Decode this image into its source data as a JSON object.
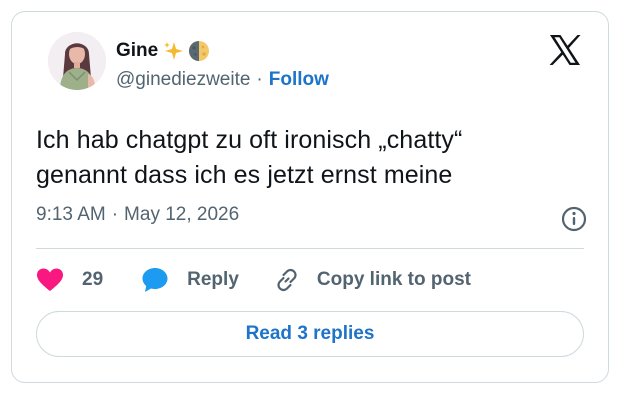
{
  "author": {
    "display_name": "Gine",
    "handle": "@ginediezweite",
    "separator": "·",
    "follow_label": "Follow",
    "emojis": [
      "sparkles-icon",
      "half-moon-icon"
    ]
  },
  "tweet": {
    "line1": "Ich hab chatgpt zu oft ironisch „chatty“",
    "line2": "genannt dass ich es jetzt ernst meine",
    "time": "9:13 AM",
    "separator": "·",
    "date": "May 12, 2026"
  },
  "actions": {
    "like_count": "29",
    "reply_label": "Reply",
    "copy_label": "Copy link to post"
  },
  "read_replies_label": "Read 3 replies",
  "colors": {
    "accent": "#1d74c8",
    "like": "#f91880",
    "reply_bubble": "#1d9bf0",
    "text": "#0f1419",
    "secondary_text": "#536471",
    "border": "#cfd9de"
  }
}
